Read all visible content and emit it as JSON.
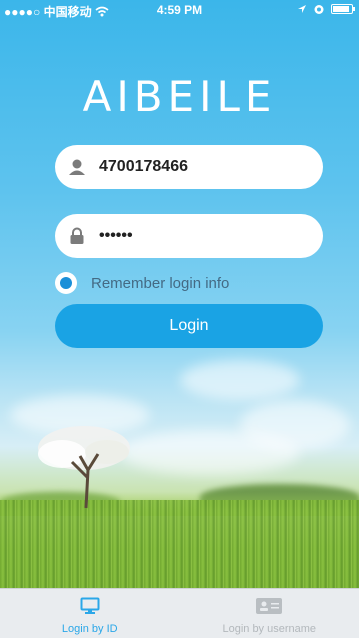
{
  "status_bar": {
    "carrier": "●●●●○ 中国移动",
    "time": "4:59 PM"
  },
  "app": {
    "logo": "AIBEILE"
  },
  "login_form": {
    "id_value": "4700178466",
    "password_value": "••••••",
    "remember_label": "Remember login info",
    "remember_checked": true,
    "login_label": "Login"
  },
  "tabs": [
    {
      "label": "Login by ID",
      "icon": "monitor-icon",
      "active": true
    },
    {
      "label": "Login by username",
      "icon": "id-card-icon",
      "active": false
    }
  ],
  "colors": {
    "accent": "#1aa3e4",
    "active_tab": "#2aa7e8",
    "inactive_tab": "#b3b8bc"
  }
}
